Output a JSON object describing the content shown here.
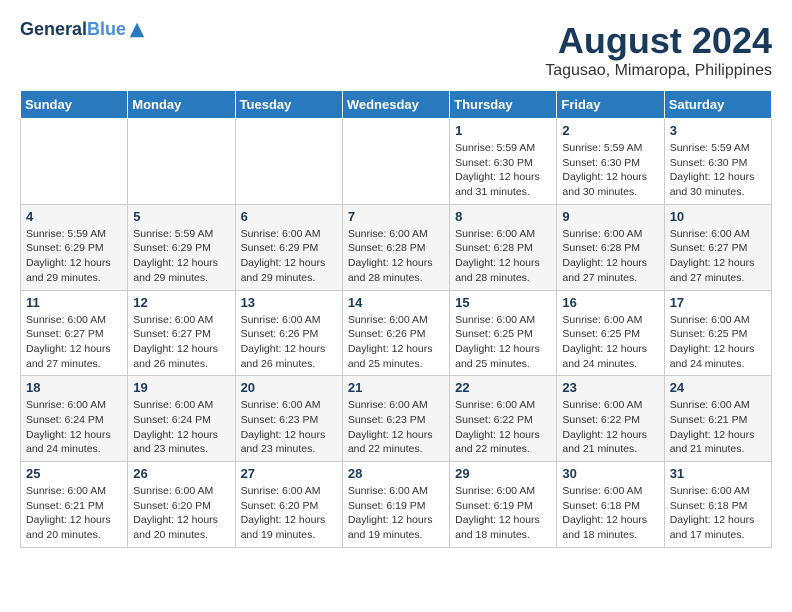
{
  "header": {
    "logo_line1": "General",
    "logo_line2": "Blue",
    "month_year": "August 2024",
    "location": "Tagusao, Mimaropa, Philippines"
  },
  "weekdays": [
    "Sunday",
    "Monday",
    "Tuesday",
    "Wednesday",
    "Thursday",
    "Friday",
    "Saturday"
  ],
  "weeks": [
    [
      {
        "day": "",
        "info": ""
      },
      {
        "day": "",
        "info": ""
      },
      {
        "day": "",
        "info": ""
      },
      {
        "day": "",
        "info": ""
      },
      {
        "day": "1",
        "info": "Sunrise: 5:59 AM\nSunset: 6:30 PM\nDaylight: 12 hours\nand 31 minutes."
      },
      {
        "day": "2",
        "info": "Sunrise: 5:59 AM\nSunset: 6:30 PM\nDaylight: 12 hours\nand 30 minutes."
      },
      {
        "day": "3",
        "info": "Sunrise: 5:59 AM\nSunset: 6:30 PM\nDaylight: 12 hours\nand 30 minutes."
      }
    ],
    [
      {
        "day": "4",
        "info": "Sunrise: 5:59 AM\nSunset: 6:29 PM\nDaylight: 12 hours\nand 29 minutes."
      },
      {
        "day": "5",
        "info": "Sunrise: 5:59 AM\nSunset: 6:29 PM\nDaylight: 12 hours\nand 29 minutes."
      },
      {
        "day": "6",
        "info": "Sunrise: 6:00 AM\nSunset: 6:29 PM\nDaylight: 12 hours\nand 29 minutes."
      },
      {
        "day": "7",
        "info": "Sunrise: 6:00 AM\nSunset: 6:28 PM\nDaylight: 12 hours\nand 28 minutes."
      },
      {
        "day": "8",
        "info": "Sunrise: 6:00 AM\nSunset: 6:28 PM\nDaylight: 12 hours\nand 28 minutes."
      },
      {
        "day": "9",
        "info": "Sunrise: 6:00 AM\nSunset: 6:28 PM\nDaylight: 12 hours\nand 27 minutes."
      },
      {
        "day": "10",
        "info": "Sunrise: 6:00 AM\nSunset: 6:27 PM\nDaylight: 12 hours\nand 27 minutes."
      }
    ],
    [
      {
        "day": "11",
        "info": "Sunrise: 6:00 AM\nSunset: 6:27 PM\nDaylight: 12 hours\nand 27 minutes."
      },
      {
        "day": "12",
        "info": "Sunrise: 6:00 AM\nSunset: 6:27 PM\nDaylight: 12 hours\nand 26 minutes."
      },
      {
        "day": "13",
        "info": "Sunrise: 6:00 AM\nSunset: 6:26 PM\nDaylight: 12 hours\nand 26 minutes."
      },
      {
        "day": "14",
        "info": "Sunrise: 6:00 AM\nSunset: 6:26 PM\nDaylight: 12 hours\nand 25 minutes."
      },
      {
        "day": "15",
        "info": "Sunrise: 6:00 AM\nSunset: 6:25 PM\nDaylight: 12 hours\nand 25 minutes."
      },
      {
        "day": "16",
        "info": "Sunrise: 6:00 AM\nSunset: 6:25 PM\nDaylight: 12 hours\nand 24 minutes."
      },
      {
        "day": "17",
        "info": "Sunrise: 6:00 AM\nSunset: 6:25 PM\nDaylight: 12 hours\nand 24 minutes."
      }
    ],
    [
      {
        "day": "18",
        "info": "Sunrise: 6:00 AM\nSunset: 6:24 PM\nDaylight: 12 hours\nand 24 minutes."
      },
      {
        "day": "19",
        "info": "Sunrise: 6:00 AM\nSunset: 6:24 PM\nDaylight: 12 hours\nand 23 minutes."
      },
      {
        "day": "20",
        "info": "Sunrise: 6:00 AM\nSunset: 6:23 PM\nDaylight: 12 hours\nand 23 minutes."
      },
      {
        "day": "21",
        "info": "Sunrise: 6:00 AM\nSunset: 6:23 PM\nDaylight: 12 hours\nand 22 minutes."
      },
      {
        "day": "22",
        "info": "Sunrise: 6:00 AM\nSunset: 6:22 PM\nDaylight: 12 hours\nand 22 minutes."
      },
      {
        "day": "23",
        "info": "Sunrise: 6:00 AM\nSunset: 6:22 PM\nDaylight: 12 hours\nand 21 minutes."
      },
      {
        "day": "24",
        "info": "Sunrise: 6:00 AM\nSunset: 6:21 PM\nDaylight: 12 hours\nand 21 minutes."
      }
    ],
    [
      {
        "day": "25",
        "info": "Sunrise: 6:00 AM\nSunset: 6:21 PM\nDaylight: 12 hours\nand 20 minutes."
      },
      {
        "day": "26",
        "info": "Sunrise: 6:00 AM\nSunset: 6:20 PM\nDaylight: 12 hours\nand 20 minutes."
      },
      {
        "day": "27",
        "info": "Sunrise: 6:00 AM\nSunset: 6:20 PM\nDaylight: 12 hours\nand 19 minutes."
      },
      {
        "day": "28",
        "info": "Sunrise: 6:00 AM\nSunset: 6:19 PM\nDaylight: 12 hours\nand 19 minutes."
      },
      {
        "day": "29",
        "info": "Sunrise: 6:00 AM\nSunset: 6:19 PM\nDaylight: 12 hours\nand 18 minutes."
      },
      {
        "day": "30",
        "info": "Sunrise: 6:00 AM\nSunset: 6:18 PM\nDaylight: 12 hours\nand 18 minutes."
      },
      {
        "day": "31",
        "info": "Sunrise: 6:00 AM\nSunset: 6:18 PM\nDaylight: 12 hours\nand 17 minutes."
      }
    ]
  ]
}
